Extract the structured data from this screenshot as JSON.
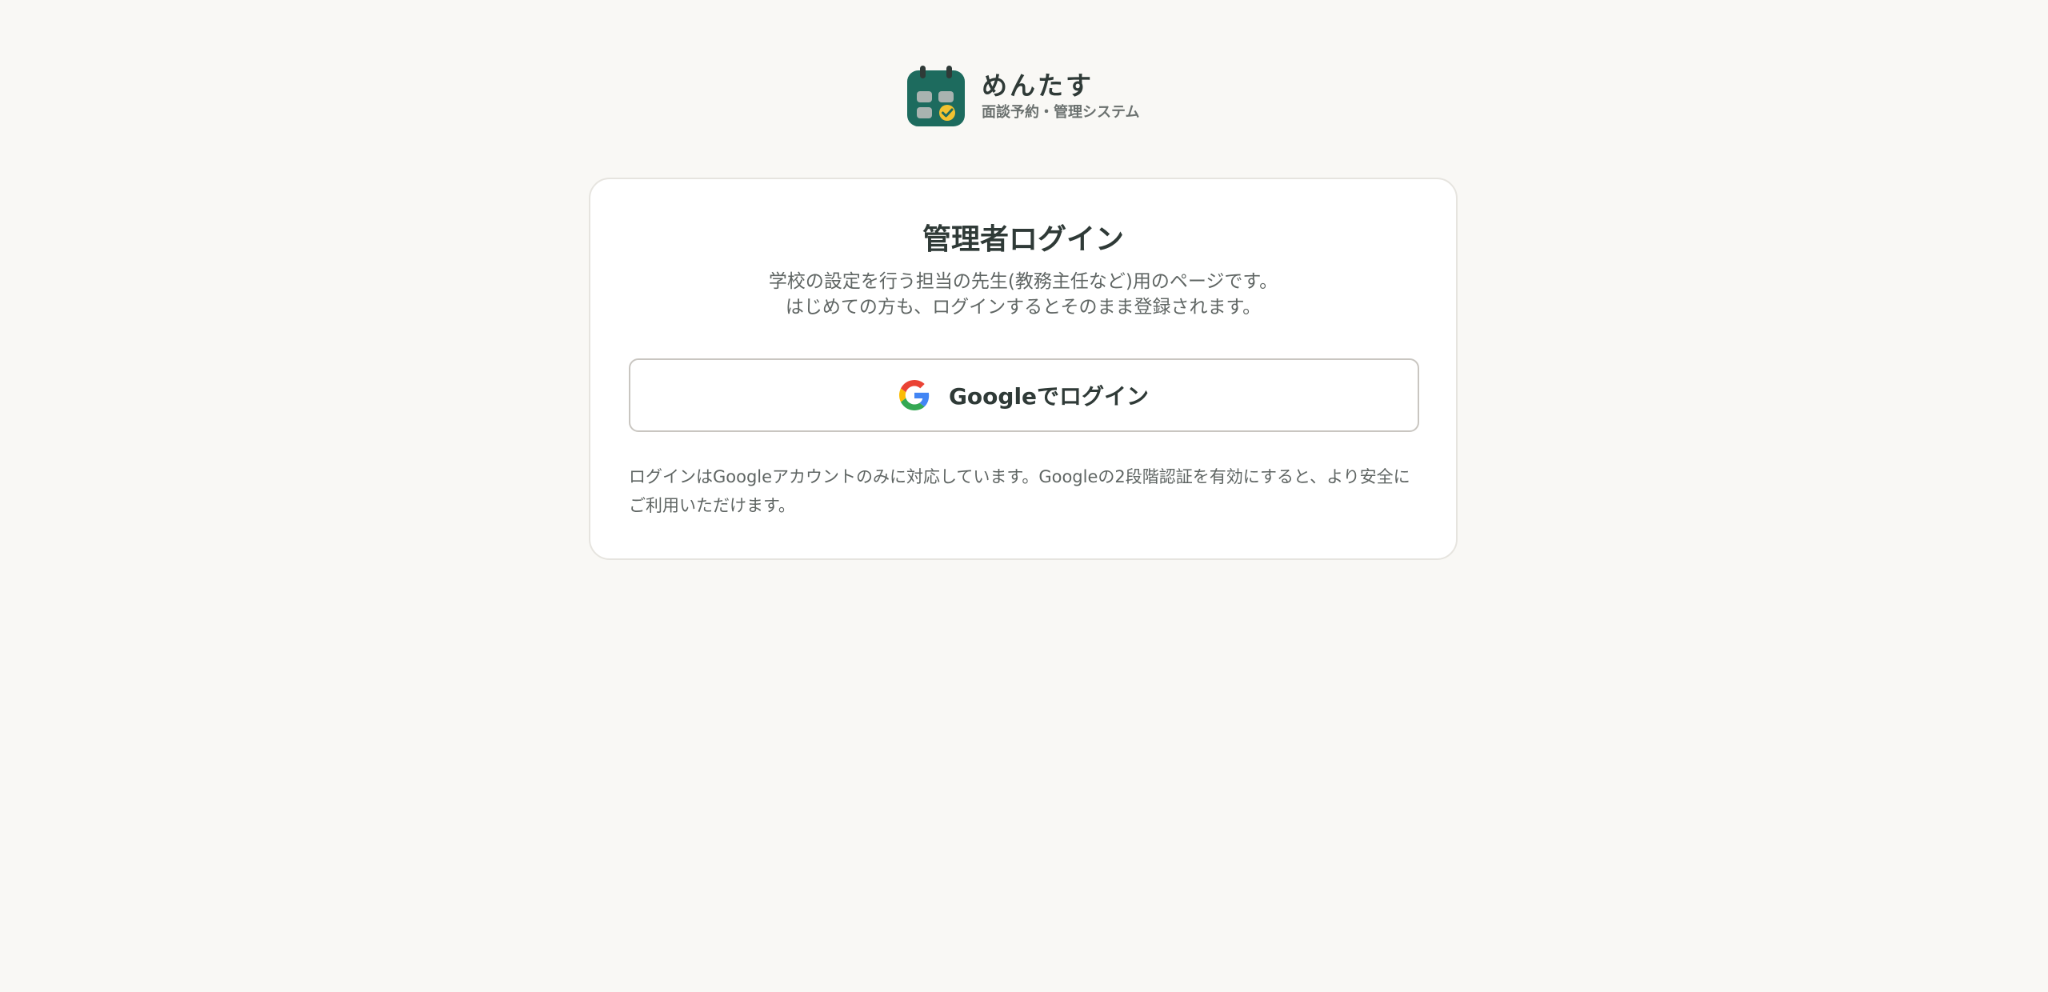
{
  "brand": {
    "name": "めんたす",
    "tagline": "面談予約・管理システム",
    "logo_icon": "calendar-check-icon",
    "colors": {
      "logo_bg": "#1d6b5e",
      "logo_cells": "#a9b3b0",
      "logo_check": "#f2c230"
    }
  },
  "login": {
    "title": "管理者ログイン",
    "description_lines": [
      "学校の設定を行う担当の先生(教務主任など)用のページです。",
      "はじめての方も、ログインするとそのまま登録されます。"
    ],
    "google_button_label": "Googleでログイン",
    "google_icon": "google-g-icon",
    "note": "ログインはGoogleアカウントのみに対応しています。Googleの2段階認証を有効にすると、より安全にご利用いただけます。"
  },
  "colors": {
    "page_bg": "#f9f8f5",
    "card_bg": "#ffffff",
    "text_primary": "#2f3a37",
    "text_secondary": "#5f6563"
  }
}
